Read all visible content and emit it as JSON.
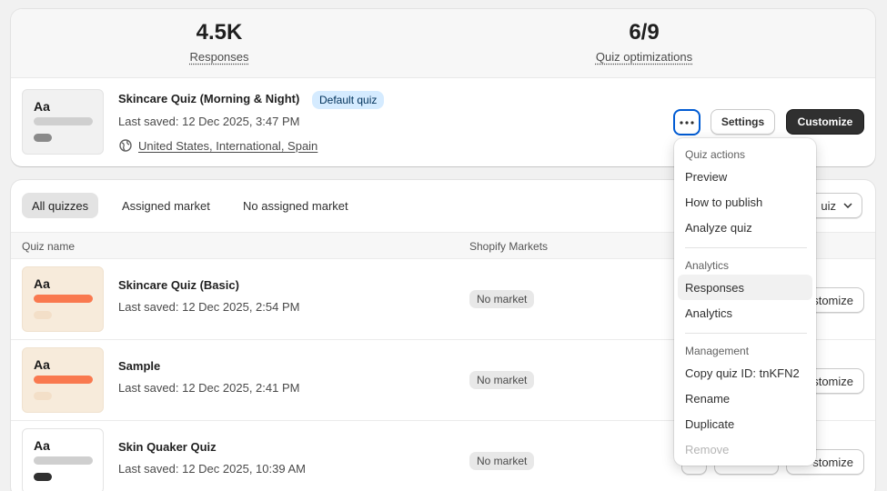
{
  "stats": {
    "responses_value": "4.5K",
    "responses_label": "Responses",
    "optimizations_value": "6/9",
    "optimizations_label": "Quiz optimizations"
  },
  "featured": {
    "thumb_text": "Aa",
    "title": "Skincare Quiz (Morning & Night)",
    "badge": "Default quiz",
    "last_saved": "Last saved: 12 Dec 2025, 3:47 PM",
    "markets": "United States, International, Spain",
    "settings_label": "Settings",
    "customize_label": "Customize"
  },
  "filters": {
    "tabs": [
      "All quizzes",
      "Assigned market",
      "No assigned market"
    ],
    "sort_fragment": "uiz"
  },
  "table": {
    "col_name": "Quiz name",
    "col_markets": "Shopify Markets",
    "rows": [
      {
        "thumb_text": "Aa",
        "name": "Skincare Quiz (Basic)",
        "last_saved": "Last saved: 12 Dec 2025, 2:54 PM",
        "market": "No market",
        "customize_fragment": "stomize"
      },
      {
        "thumb_text": "Aa",
        "name": "Sample",
        "last_saved": "Last saved: 12 Dec 2025, 2:41 PM",
        "market": "No market",
        "customize_fragment": "stomize"
      },
      {
        "thumb_text": "Aa",
        "name": "Skin Quaker Quiz",
        "last_saved": "Last saved: 12 Dec 2025, 10:39 AM",
        "market": "No market",
        "customize_fragment": "stomize"
      }
    ]
  },
  "menu": {
    "section1": "Quiz actions",
    "preview": "Preview",
    "how_to_publish": "How to publish",
    "analyze": "Analyze quiz",
    "section2": "Analytics",
    "responses": "Responses",
    "analytics": "Analytics",
    "section3": "Management",
    "copy_id": "Copy quiz ID: tnKFN2",
    "rename": "Rename",
    "duplicate": "Duplicate",
    "remove": "Remove"
  },
  "colors": {
    "accent_blue": "#005bd3",
    "dark_button": "#303030",
    "badge_blue": "#d5ebff",
    "thumb_orange": "#f9794f",
    "thumb_cream": "#f7ebdb"
  }
}
